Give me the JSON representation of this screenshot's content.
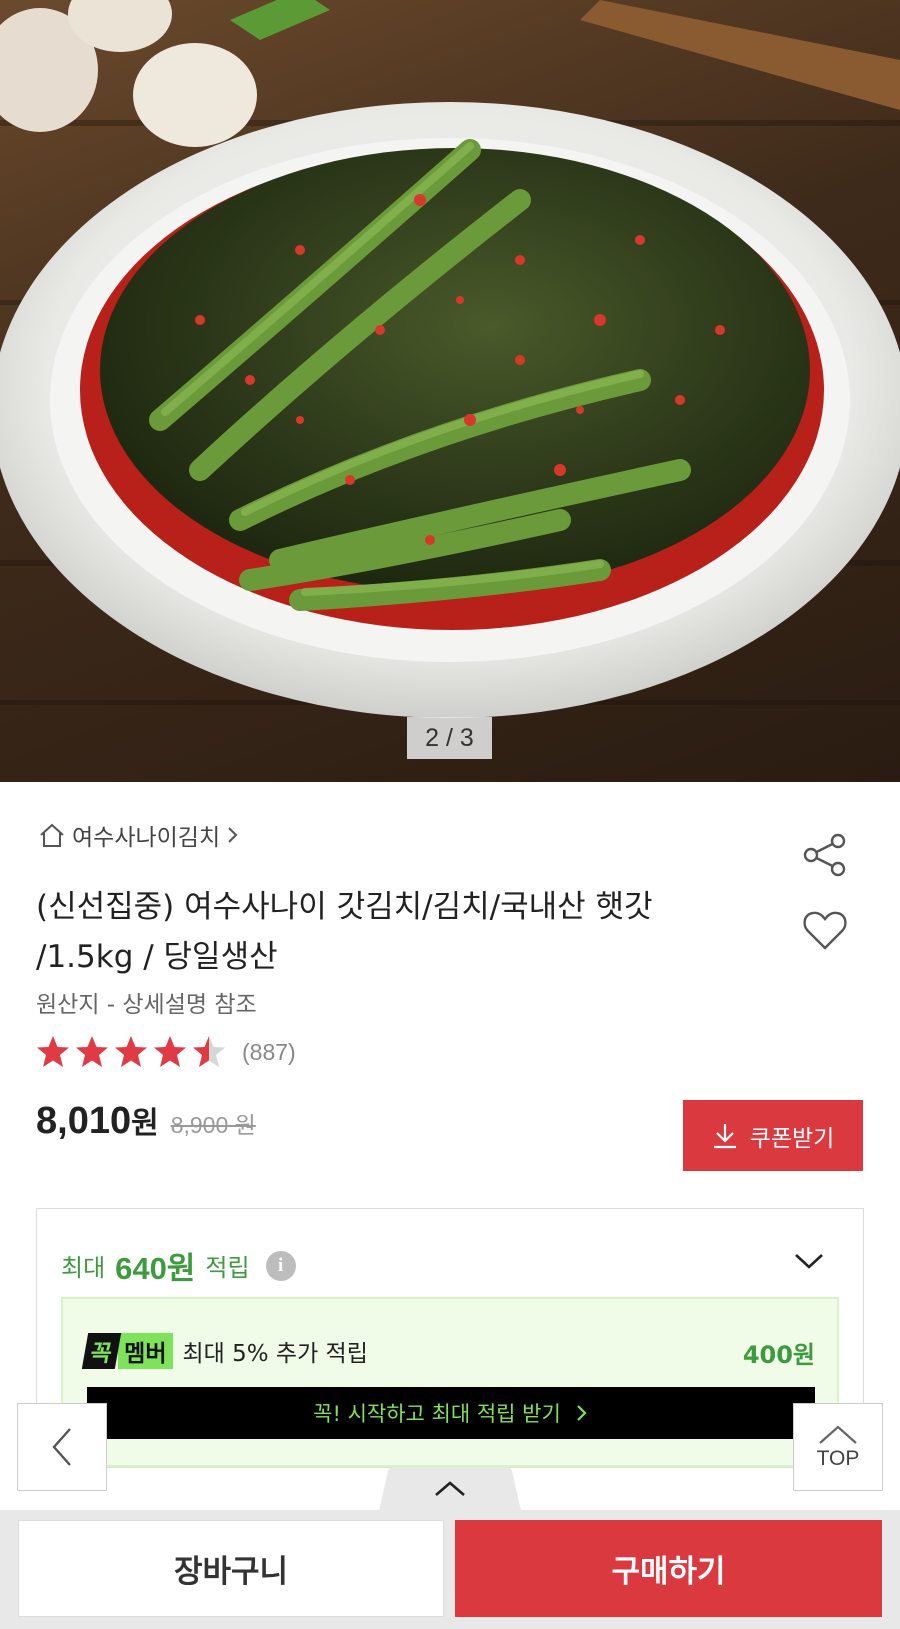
{
  "gallery": {
    "page_indicator": "2 / 3",
    "current_page": 2,
    "total_pages": 3
  },
  "product": {
    "store_name": "여수사나이김치",
    "title_line1": "(신선집중) 여수사나이 갓김치/김치/국내산 햇갓",
    "title_line2": "/1.5kg / 당일생산",
    "origin": "원산지 - 상세설명 참조",
    "rating": 4.5,
    "rating_max": 5,
    "review_count": "(887)",
    "price": "8,010",
    "price_unit": "원",
    "original_price": "8,900 원"
  },
  "coupon": {
    "label": "쿠폰받기"
  },
  "points": {
    "prefix": "최대",
    "amount": "640원",
    "suffix": "적립",
    "info_glyph": "i"
  },
  "membership": {
    "badge_part1": "꼭",
    "badge_part2": "멤버",
    "text": "최대 5% 추가 적립",
    "points": "400원",
    "cta": "꼭! 시작하고 최대 적립 받기"
  },
  "floating": {
    "top_label": "TOP"
  },
  "bottom_bar": {
    "cart_label": "장바구니",
    "buy_label": "구매하기"
  },
  "colors": {
    "accent_red": "#d9393f",
    "points_green": "#3d9a3d",
    "member_green": "#7ee35a",
    "star_red": "#e03a45"
  }
}
